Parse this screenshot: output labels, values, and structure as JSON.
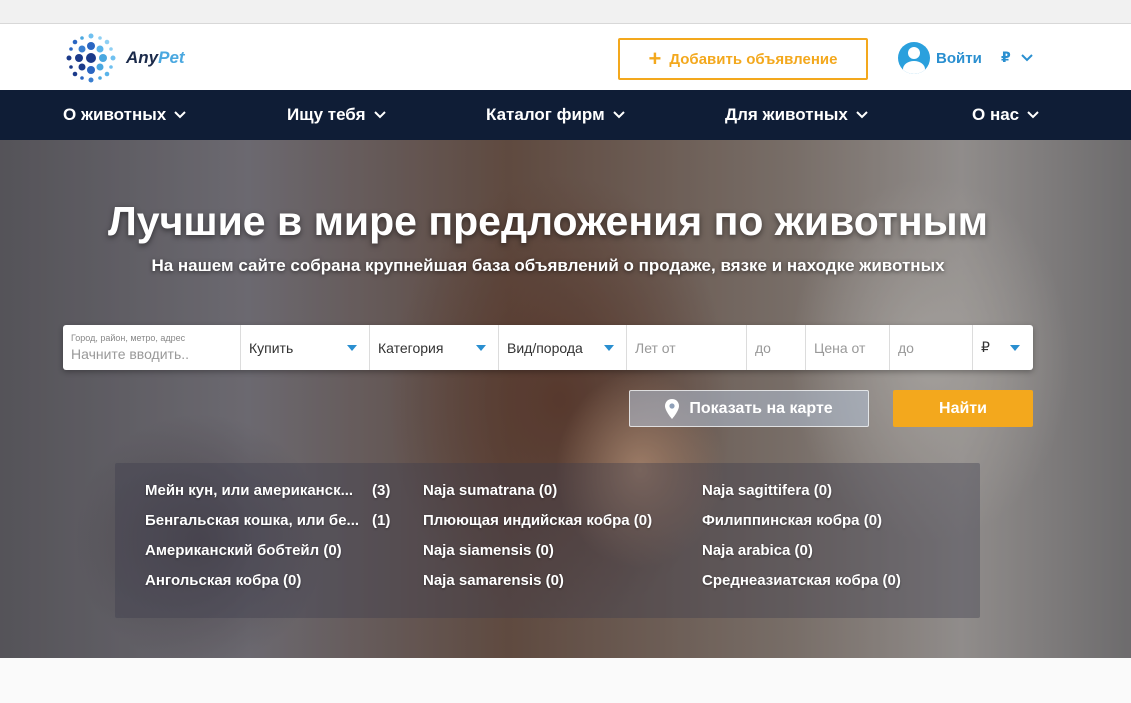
{
  "header": {
    "logo_text_a": "Any",
    "logo_text_b": "Pet",
    "add_button": "Добавить объявление",
    "login": "Войти",
    "currency": "₽"
  },
  "nav": [
    {
      "label": "О животных"
    },
    {
      "label": "Ищу тебя"
    },
    {
      "label": "Каталог фирм"
    },
    {
      "label": "Для животных"
    },
    {
      "label": "О нас"
    }
  ],
  "hero": {
    "title": "Лучшие в мире предложения по животным",
    "subtitle": "На нашем сайте собрана крупнейшая база объявлений о продаже, вязке и находке животных"
  },
  "search": {
    "city_label": "Город, район, метро, адрес",
    "city_placeholder": "Начните вводить..",
    "deal": "Купить",
    "category": "Категория",
    "breed": "Вид/порода",
    "age_from": "Лет от",
    "age_to": "до",
    "price_from": "Цена от",
    "price_to": "до",
    "currency": "₽",
    "map_button": "Показать на карте",
    "find_button": "Найти"
  },
  "popular": [
    {
      "label": "Мейн кун, или американск...",
      "count": "(3)"
    },
    {
      "label": "Бенгальская кошка, или бе...",
      "count": "(1)"
    },
    {
      "label": "Американский бобтейл (0)",
      "count": ""
    },
    {
      "label": "Ангольская кобра (0)",
      "count": ""
    },
    {
      "label": "Naja sumatrana (0)",
      "count": ""
    },
    {
      "label": "Плюющая индийская кобра (0)",
      "count": ""
    },
    {
      "label": "Naja siamensis (0)",
      "count": ""
    },
    {
      "label": "Naja samarensis (0)",
      "count": ""
    },
    {
      "label": "Naja sagittifera (0)",
      "count": ""
    },
    {
      "label": "Филиппинская кобра (0)",
      "count": ""
    },
    {
      "label": "Naja arabica (0)",
      "count": ""
    },
    {
      "label": "Среднеазиатская кобра (0)",
      "count": ""
    }
  ],
  "colors": {
    "accent": "#f3a81d",
    "nav_bg": "#0f1d36",
    "link": "#2a8fd0"
  }
}
